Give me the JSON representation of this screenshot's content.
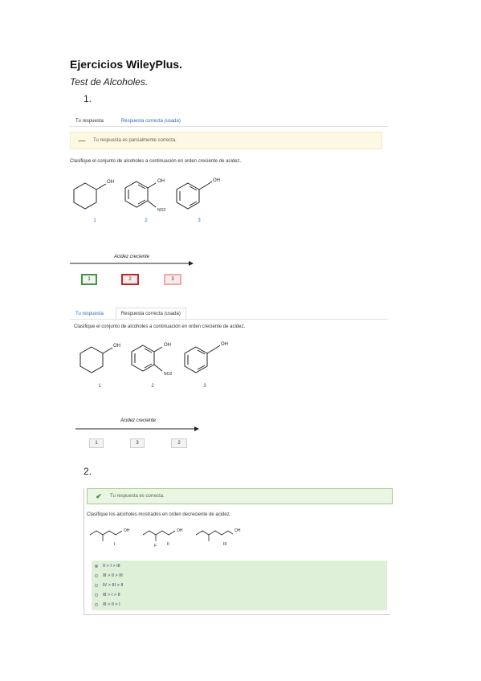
{
  "header": {
    "title": "Ejercicios WileyPlus.",
    "subtitle": "Test de Alcoholes."
  },
  "question1": {
    "number": "1.",
    "tabs": [
      "Tu respuesta",
      "Respuesta correcta (usada)"
    ],
    "banner_text": "Tu respuesta es parcialmente correcta.",
    "prompt": "Clasifique el conjunto de alcoholes a continuación en orden creciente de acidez.",
    "prompt_b": "Clasifique el conjunto de alcoholes a continuación en orden creciente de acidez.",
    "mol_numbers": [
      "1",
      "2",
      "3"
    ],
    "labels": {
      "oh": "OH",
      "no2": "NO2"
    },
    "arrow_label": "Acidez creciente",
    "your_answer": [
      "1",
      "2",
      "3"
    ],
    "correct_answer": [
      "1",
      "3",
      "2"
    ]
  },
  "question2": {
    "number": "2.",
    "banner_text": "Tu respuesta es correcta.",
    "prompt": "Clasifique los alcoholes mostrados en orden decreciente de acidez.",
    "mol_labels": [
      "I",
      "II",
      "III"
    ],
    "f_label": "F",
    "options": [
      "II > I > III",
      "III > II > III",
      "IV > III > II",
      "III > I > II",
      "III > II > I"
    ]
  },
  "colors": {
    "link": "#2a6ebb",
    "correct": "#4a8f4a",
    "wrong": "#c0272d",
    "partial_bg": "#fcf8e3",
    "correct_bg": "#dff0d8"
  }
}
